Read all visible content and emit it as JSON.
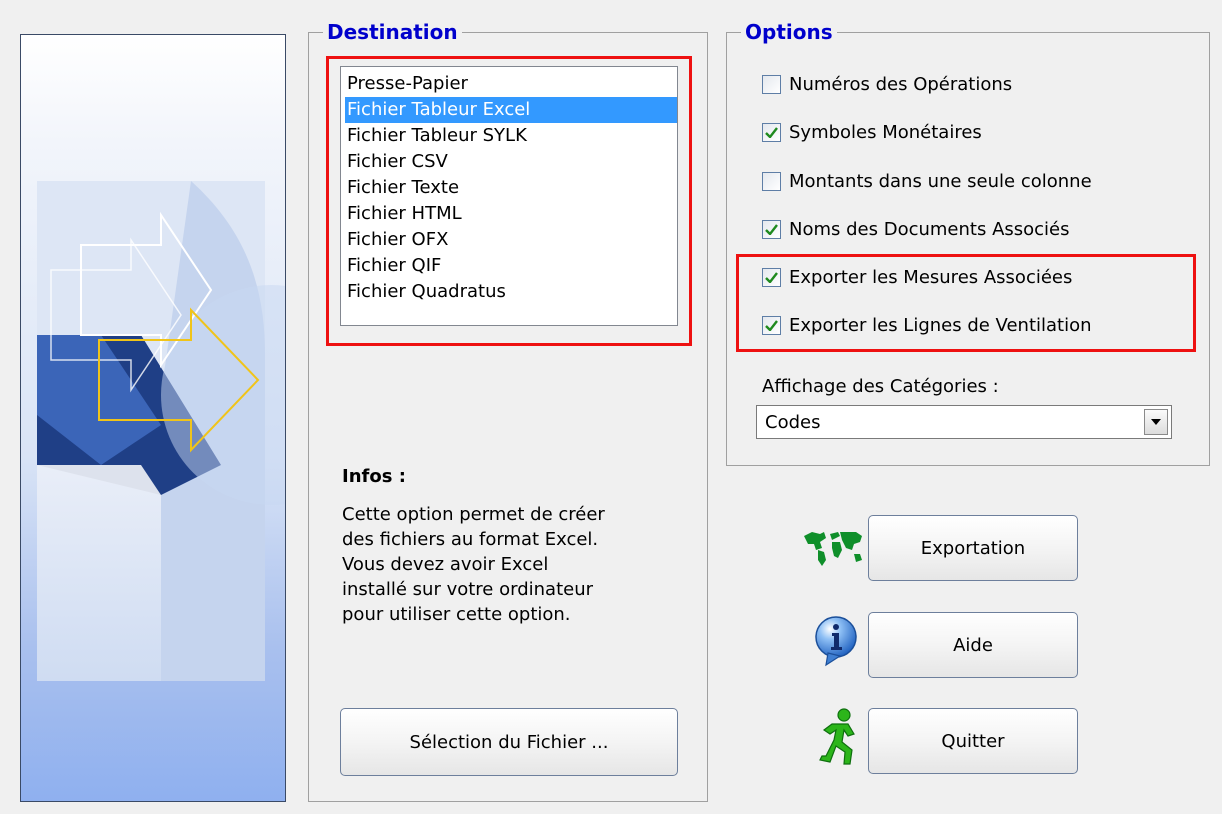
{
  "destination": {
    "title": "Destination",
    "items": [
      {
        "label": "Presse-Papier",
        "selected": false
      },
      {
        "label": "Fichier Tableur Excel",
        "selected": true
      },
      {
        "label": "Fichier Tableur SYLK",
        "selected": false
      },
      {
        "label": "Fichier CSV",
        "selected": false
      },
      {
        "label": "Fichier Texte",
        "selected": false
      },
      {
        "label": "Fichier HTML",
        "selected": false
      },
      {
        "label": "Fichier OFX",
        "selected": false
      },
      {
        "label": "Fichier QIF",
        "selected": false
      },
      {
        "label": "Fichier Quadratus",
        "selected": false
      }
    ]
  },
  "infos": {
    "title": "Infos :",
    "lines": [
      "Cette option permet de créer",
      "des fichiers au format Excel.",
      "Vous devez avoir Excel",
      "installé sur votre ordinateur",
      "pour utiliser cette option."
    ]
  },
  "select_file_label": "Sélection du Fichier ...",
  "options": {
    "title": "Options",
    "checkboxes": [
      {
        "label": "Numéros des Opérations",
        "checked": false
      },
      {
        "label": "Symboles Monétaires",
        "checked": true
      },
      {
        "label": "Montants dans une seule colonne",
        "checked": false
      },
      {
        "label": "Noms des Documents Associés",
        "checked": true
      },
      {
        "label": "Exporter les Mesures Associées",
        "checked": true
      },
      {
        "label": "Exporter les Lignes de Ventilation",
        "checked": true
      }
    ],
    "category_label": "Affichage des Catégories :",
    "category_value": "Codes"
  },
  "actions": {
    "export_label": "Exportation",
    "help_label": "Aide",
    "quit_label": "Quitter"
  },
  "colors": {
    "group_title": "#0000cc",
    "highlight": "#ee1111",
    "selection": "#3399ff",
    "check": "#1f8a1f"
  },
  "icons": {
    "export": "world-map-icon",
    "help": "info-bubble-icon",
    "quit": "running-man-icon"
  }
}
